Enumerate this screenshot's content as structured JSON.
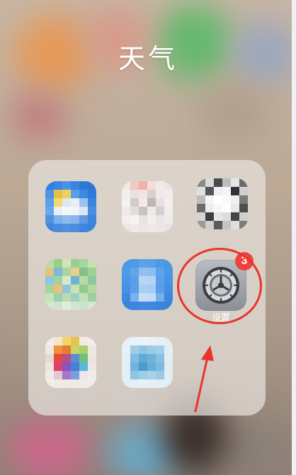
{
  "folder": {
    "title": "天气"
  },
  "apps": [
    {
      "name": "blurred-app-1"
    },
    {
      "name": "blurred-app-2"
    },
    {
      "name": "blurred-app-3"
    },
    {
      "name": "blurred-app-4"
    },
    {
      "name": "blurred-app-5"
    },
    {
      "name": "blurred-app-6"
    },
    {
      "name": "blurred-app-7"
    },
    {
      "name": "blurred-app-8"
    }
  ],
  "settings_app": {
    "label": "设置",
    "badge": "3",
    "icon": "gear-icon"
  },
  "annotation": {
    "color": "#e8342c",
    "shapes": [
      "circle-highlight",
      "arrow-up"
    ]
  },
  "colors": {
    "badge": "#f0423c",
    "annotation": "#e8342c"
  }
}
